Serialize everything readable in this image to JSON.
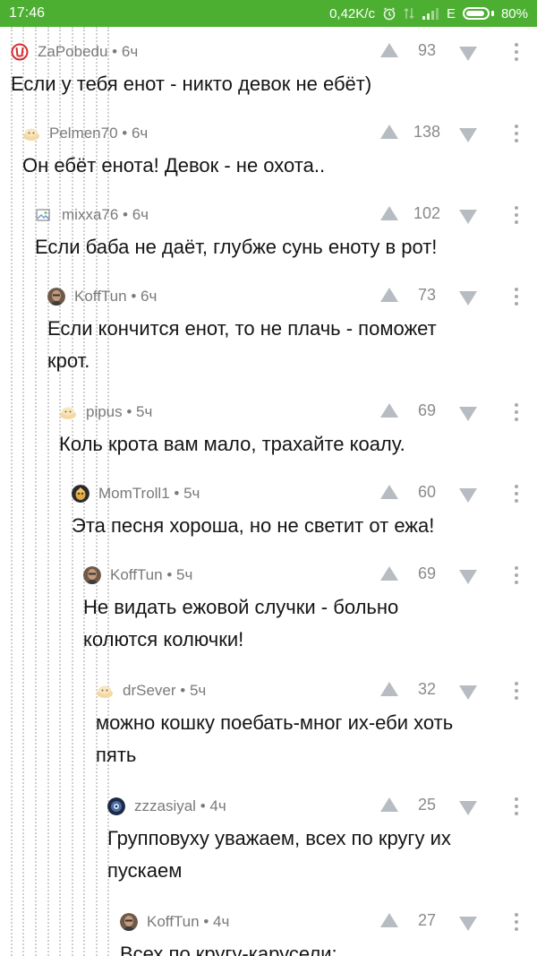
{
  "status_bar": {
    "time": "17:46",
    "speed": "0,42K/c",
    "network": "E",
    "battery": "80%",
    "icons": [
      "alarm-icon",
      "data-transfer-icon",
      "signal-icon",
      "battery-icon"
    ]
  },
  "colors": {
    "status_bar": "#4caf32",
    "vote_arrow": "#b6bcc2",
    "author": "#7a7a7a",
    "guide_line": "#cfcfcf"
  },
  "comments": [
    {
      "author": "ZaPobedu",
      "time": "6ч",
      "rating": "93",
      "avatar": "victory-sign-icon",
      "text": [
        "Если у тебя енот - никто девок не ебёт)"
      ]
    },
    {
      "author": "Pelmen70",
      "time": "6ч",
      "rating": "138",
      "avatar": "default-avatar-icon",
      "text": [
        "Он ебёт енота! Девок - не охота.."
      ]
    },
    {
      "author": "mixxa76",
      "time": "6ч",
      "rating": "102",
      "avatar": "broken-image-icon",
      "text": [
        "Если баба не даёт, глубже сунь еноту в рот!"
      ]
    },
    {
      "author": "KoffTun",
      "time": "6ч",
      "rating": "73",
      "avatar": "user-photo-avatar",
      "text": [
        "Если кончится енот, то не плачь - поможет",
        "крот."
      ]
    },
    {
      "author": "pipus",
      "time": "5ч",
      "rating": "69",
      "avatar": "default-avatar-icon",
      "text": [
        "Коль крота вам мало, трахайте коалу."
      ]
    },
    {
      "author": "MomTroll1",
      "time": "5ч",
      "rating": "60",
      "avatar": "user-photo-avatar",
      "text": [
        "Эта песня хороша, но не светит от ежа!"
      ]
    },
    {
      "author": "KoffTun",
      "time": "5ч",
      "rating": "69",
      "avatar": "user-photo-avatar",
      "text": [
        "Не видать ежовой случки - больно",
        "колются колючки!"
      ]
    },
    {
      "author": "drSever",
      "time": "5ч",
      "rating": "32",
      "avatar": "default-avatar-icon",
      "text": [
        "можно кошку поебать-мног их-еби хоть",
        "пять"
      ]
    },
    {
      "author": "zzzasiyal",
      "time": "4ч",
      "rating": "25",
      "avatar": "user-photo-avatar",
      "text": [
        "Групповуху уважаем, всех по кругу их",
        "пускаем"
      ]
    },
    {
      "author": "KoffTun",
      "time": "4ч",
      "rating": "27",
      "avatar": "user-photo-avatar",
      "text": [
        "Всех по кругу-карусели;"
      ]
    }
  ]
}
